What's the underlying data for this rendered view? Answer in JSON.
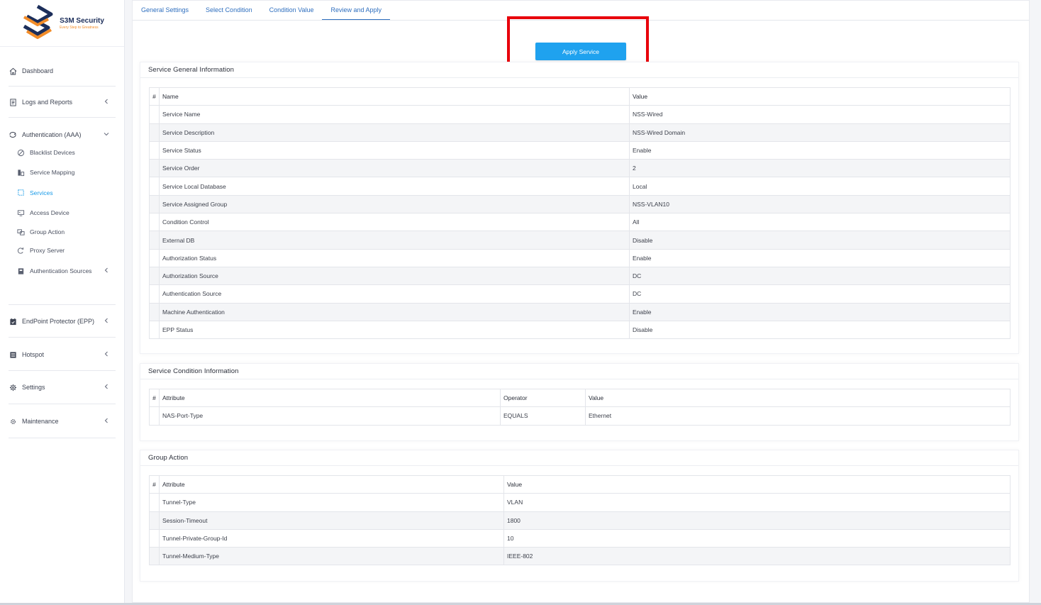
{
  "brand": {
    "name": "S3M Security",
    "slogan": "Every Step to Greatness",
    "colors": {
      "navy": "#1c2e5a",
      "orange": "#f28c28",
      "accent": "#1a9be8"
    }
  },
  "sidebar": {
    "dashboard": "Dashboard",
    "logs": "Logs and Reports",
    "aaa": "Authentication (AAA)",
    "aaa_items": [
      {
        "label": "Blacklist Devices",
        "icon": "ban-icon"
      },
      {
        "label": "Service Mapping",
        "icon": "mapping-icon"
      },
      {
        "label": "Services",
        "icon": "services-icon"
      },
      {
        "label": "Access Device",
        "icon": "device-icon"
      },
      {
        "label": "Group Action",
        "icon": "group-icon"
      },
      {
        "label": "Proxy Server",
        "icon": "proxy-icon"
      },
      {
        "label": "Authentication Sources",
        "icon": "sources-icon"
      }
    ],
    "epp": "EndPoint Protector (EPP)",
    "hotspot": "Hotspot",
    "settings": "Settings",
    "maintenance": "Maintenance"
  },
  "tabs": [
    "General Settings",
    "Select Condition",
    "Condition Value",
    "Review and Apply"
  ],
  "apply_button": "Apply Service",
  "general": {
    "title": "Service General Information",
    "headers": {
      "idx": "#",
      "name": "Name",
      "value": "Value"
    },
    "rows": [
      {
        "name": "Service Name",
        "value": "NSS-Wired"
      },
      {
        "name": "Service Description",
        "value": "NSS-Wired Domain"
      },
      {
        "name": "Service Status",
        "value": "Enable"
      },
      {
        "name": "Service Order",
        "value": "2"
      },
      {
        "name": "Service Local Database",
        "value": "Local"
      },
      {
        "name": "Service Assigned Group",
        "value": "NSS-VLAN10"
      },
      {
        "name": "Condition Control",
        "value": "All"
      },
      {
        "name": "External DB",
        "value": "Disable"
      },
      {
        "name": "Authorization Status",
        "value": "Enable"
      },
      {
        "name": "Authorization Source",
        "value": "DC"
      },
      {
        "name": "Authentication Source",
        "value": "DC"
      },
      {
        "name": "Machine Authentication",
        "value": "Enable"
      },
      {
        "name": "EPP Status",
        "value": "Disable"
      }
    ]
  },
  "condition": {
    "title": "Service Condition Information",
    "headers": {
      "idx": "#",
      "attribute": "Attribute",
      "operator": "Operator",
      "value": "Value"
    },
    "rows": [
      {
        "attribute": "NAS-Port-Type",
        "operator": "EQUALS",
        "value": "Ethernet"
      }
    ]
  },
  "group_action": {
    "title": "Group Action",
    "headers": {
      "idx": "#",
      "attribute": "Attribute",
      "value": "Value"
    },
    "rows": [
      {
        "attribute": "Tunnel-Type",
        "value": "VLAN"
      },
      {
        "attribute": "Session-Timeout",
        "value": "1800"
      },
      {
        "attribute": "Tunnel-Private-Group-Id",
        "value": "10"
      },
      {
        "attribute": "Tunnel-Medium-Type",
        "value": "IEEE-802"
      }
    ]
  }
}
